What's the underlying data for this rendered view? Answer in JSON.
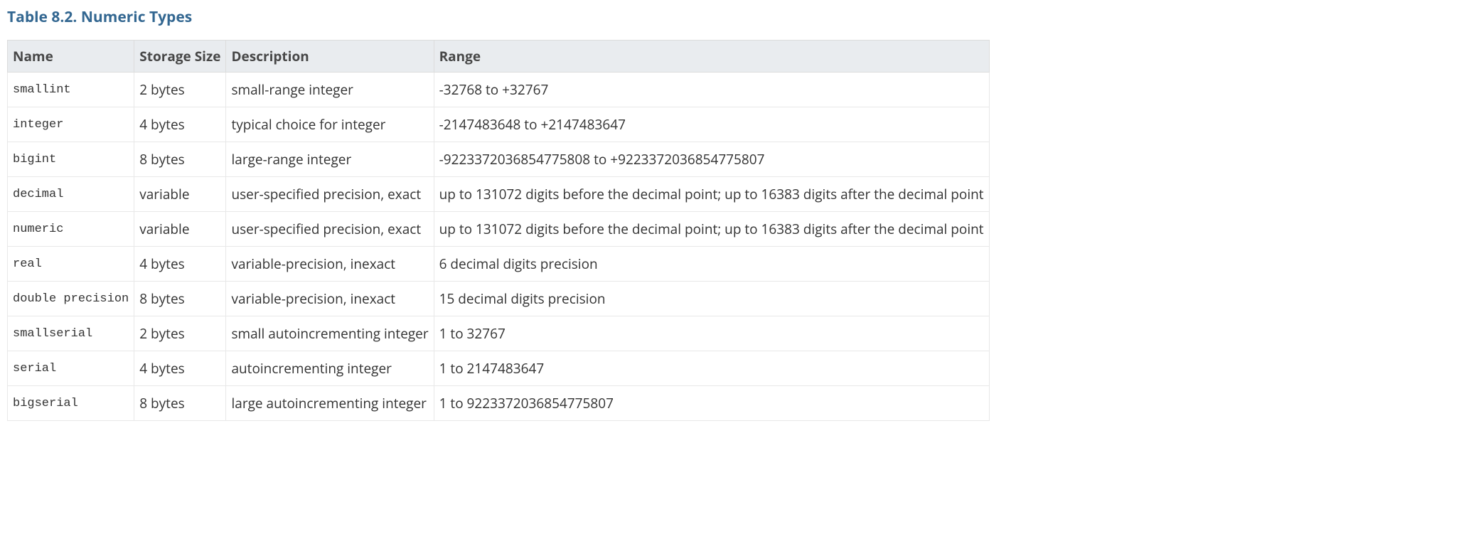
{
  "title": "Table 8.2. Numeric Types",
  "columns": [
    "Name",
    "Storage Size",
    "Description",
    "Range"
  ],
  "rows": [
    {
      "name": "smallint",
      "storage": "2 bytes",
      "description": "small-range integer",
      "range": "-32768 to +32767"
    },
    {
      "name": "integer",
      "storage": "4 bytes",
      "description": "typical choice for integer",
      "range": "-2147483648 to +2147483647"
    },
    {
      "name": "bigint",
      "storage": "8 bytes",
      "description": "large-range integer",
      "range": "-9223372036854775808 to +9223372036854775807"
    },
    {
      "name": "decimal",
      "storage": "variable",
      "description": "user-specified precision, exact",
      "range": "up to 131072 digits before the decimal point; up to 16383 digits after the decimal point"
    },
    {
      "name": "numeric",
      "storage": "variable",
      "description": "user-specified precision, exact",
      "range": "up to 131072 digits before the decimal point; up to 16383 digits after the decimal point"
    },
    {
      "name": "real",
      "storage": "4 bytes",
      "description": "variable-precision, inexact",
      "range": "6 decimal digits precision"
    },
    {
      "name": "double precision",
      "storage": "8 bytes",
      "description": "variable-precision, inexact",
      "range": "15 decimal digits precision"
    },
    {
      "name": "smallserial",
      "storage": "2 bytes",
      "description": "small autoincrementing integer",
      "range": "1 to 32767"
    },
    {
      "name": "serial",
      "storage": "4 bytes",
      "description": "autoincrementing integer",
      "range": "1 to 2147483647"
    },
    {
      "name": "bigserial",
      "storage": "8 bytes",
      "description": "large autoincrementing integer",
      "range": "1 to 9223372036854775807"
    }
  ]
}
